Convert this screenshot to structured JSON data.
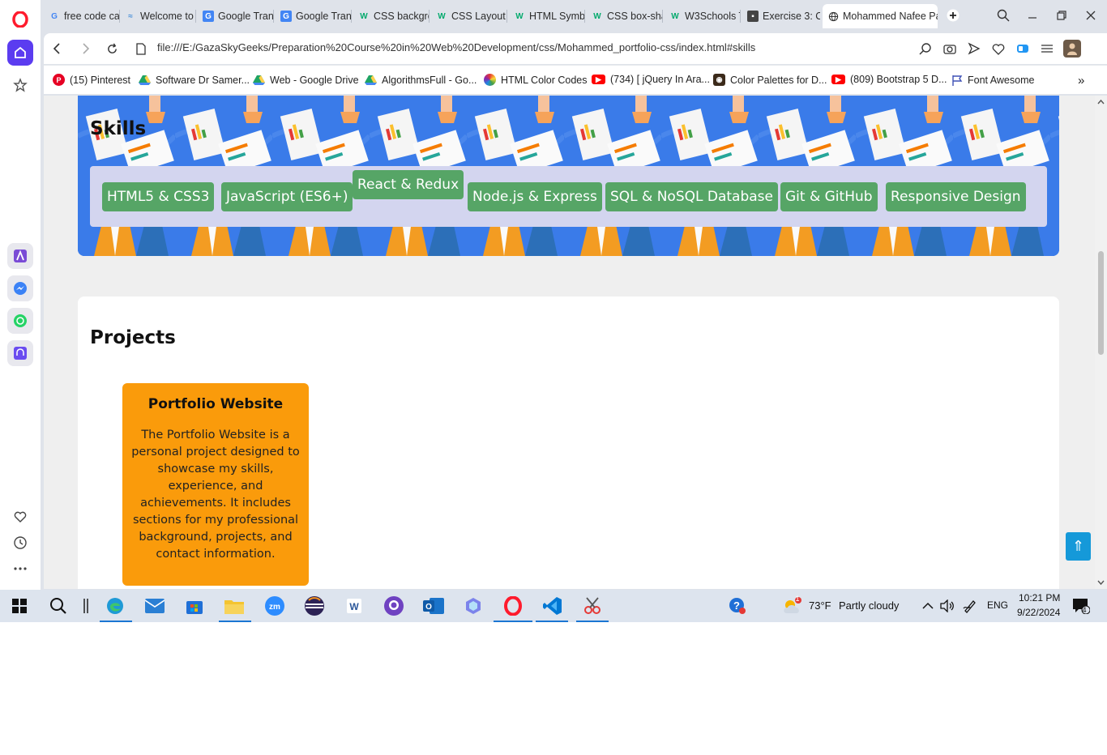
{
  "browser": {
    "tabs": [
      {
        "title": "free code ca",
        "icon": "google-icon"
      },
      {
        "title": "Welcome to",
        "icon": "wave-icon"
      },
      {
        "title": "Google Tran",
        "icon": "google-translate-icon"
      },
      {
        "title": "Google Tran",
        "icon": "google-translate-icon"
      },
      {
        "title": "CSS backgro",
        "icon": "w3schools-icon"
      },
      {
        "title": "CSS Layout -",
        "icon": "w3schools-icon"
      },
      {
        "title": "HTML Symb",
        "icon": "w3schools-icon"
      },
      {
        "title": "CSS box-sha",
        "icon": "w3schools-icon"
      },
      {
        "title": "W3Schools T",
        "icon": "w3schools-icon"
      },
      {
        "title": "Exercise 3: C",
        "icon": "classroom-icon"
      },
      {
        "title": "Mohammed Nafee Pa",
        "icon": "globe-icon",
        "active": true
      }
    ],
    "url": "file:///E:/GazaSkyGeeks/Preparation%20Course%20in%20Web%20Development/css/Mohammed_portfolio-css/index.html#skills",
    "bookmarks": [
      {
        "label": "(15) Pinterest",
        "icon": "pinterest-icon",
        "color": "#e60023"
      },
      {
        "label": "Software Dr Samer...",
        "icon": "google-drive-icon",
        "color": "#1fa463"
      },
      {
        "label": "Web - Google Drive",
        "icon": "google-drive-icon",
        "color": "#1fa463"
      },
      {
        "label": "AlgorithmsFull - Go...",
        "icon": "google-drive-icon",
        "color": "#1fa463"
      },
      {
        "label": "HTML Color Codes",
        "icon": "color-wheel-icon",
        "color": "#7b2fbf"
      },
      {
        "label": "(734) [ jQuery In Ara...",
        "icon": "youtube-icon",
        "color": "#ff0000"
      },
      {
        "label": "Color Palettes for D...",
        "icon": "palette-icon",
        "color": "#3b2a1a"
      },
      {
        "label": "(809) Bootstrap 5 D...",
        "icon": "youtube-icon",
        "color": "#ff0000"
      },
      {
        "label": "Font Awesome",
        "icon": "flag-icon",
        "color": "#3f51b5"
      }
    ]
  },
  "page": {
    "skills_title": "Skills",
    "skills": [
      "HTML5 & CSS3",
      "JavaScript (ES6+)",
      "React & Redux",
      "Node.js & Express",
      "SQL & NoSQL Database",
      "Git & GitHub",
      "Responsive Design"
    ],
    "projects_title": "Projects",
    "project": {
      "title": "Portfolio Website",
      "description": "The Portfolio Website is a personal project designed to showcase my skills, experience, and achievements. It includes sections for my professional background, projects, and contact information."
    },
    "back_to_top": "⇑"
  },
  "taskbar": {
    "weather_temp": "73°F",
    "weather_desc": "Partly cloudy",
    "weather_badge": "1",
    "language": "ENG",
    "time": "10:21 PM",
    "date": "9/22/2024",
    "notification_count": "4"
  },
  "colors": {
    "skill_tag": "#56a566",
    "skills_panel": "#d3d5ef",
    "skills_banner": "#3b7ae8",
    "project_card": "#fa9b0b",
    "back_to_top": "#1599d9"
  }
}
